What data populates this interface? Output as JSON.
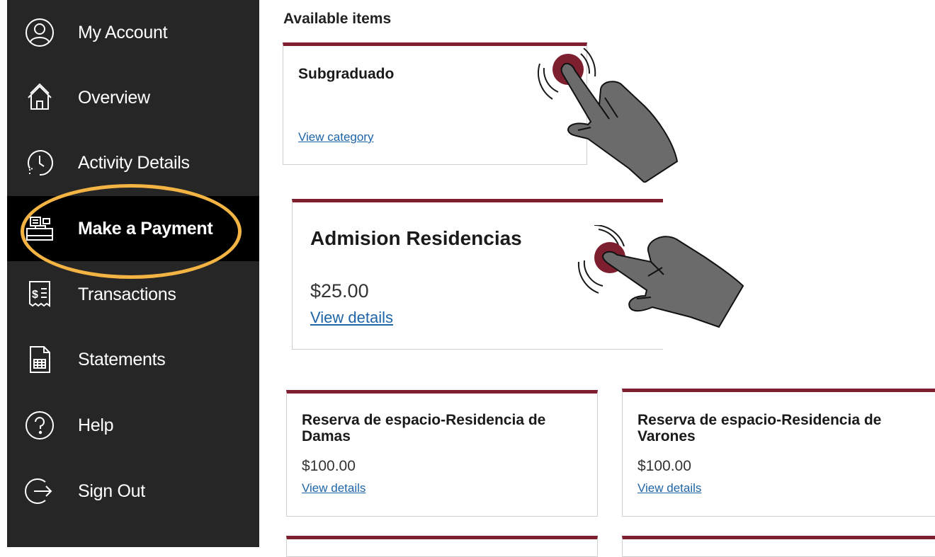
{
  "sidebar": {
    "items": [
      {
        "label": "My Account",
        "icon": "user-circle-icon"
      },
      {
        "label": "Overview",
        "icon": "home-icon"
      },
      {
        "label": "Activity Details",
        "icon": "clock-icon"
      },
      {
        "label": "Make a Payment",
        "icon": "cash-register-icon",
        "active": true
      },
      {
        "label": "Transactions",
        "icon": "receipt-icon"
      },
      {
        "label": "Statements",
        "icon": "statement-document-icon"
      },
      {
        "label": "Help",
        "icon": "help-icon"
      },
      {
        "label": "Sign Out",
        "icon": "sign-out-icon"
      }
    ]
  },
  "main": {
    "section_title": "Available items",
    "categories": [
      {
        "title": "Subgraduado",
        "link": "View category"
      }
    ],
    "items": [
      {
        "title": "Admision Residencias",
        "price": "$25.00",
        "link": "View details"
      },
      {
        "title": "Reserva de espacio-Residencia de Damas",
        "price": "$100.00",
        "link": "View details"
      },
      {
        "title": "Reserva de espacio-Residencia de Varones",
        "price": "$100.00",
        "link": "View details"
      }
    ]
  },
  "colors": {
    "sidebar_bg": "#262626",
    "active_bg": "#000000",
    "highlight": "#f3b443",
    "card_accent": "#7d1f2e",
    "link": "#1e64a6",
    "tap_marker": "#7d1f2e",
    "hand": "#6b6b6b"
  }
}
